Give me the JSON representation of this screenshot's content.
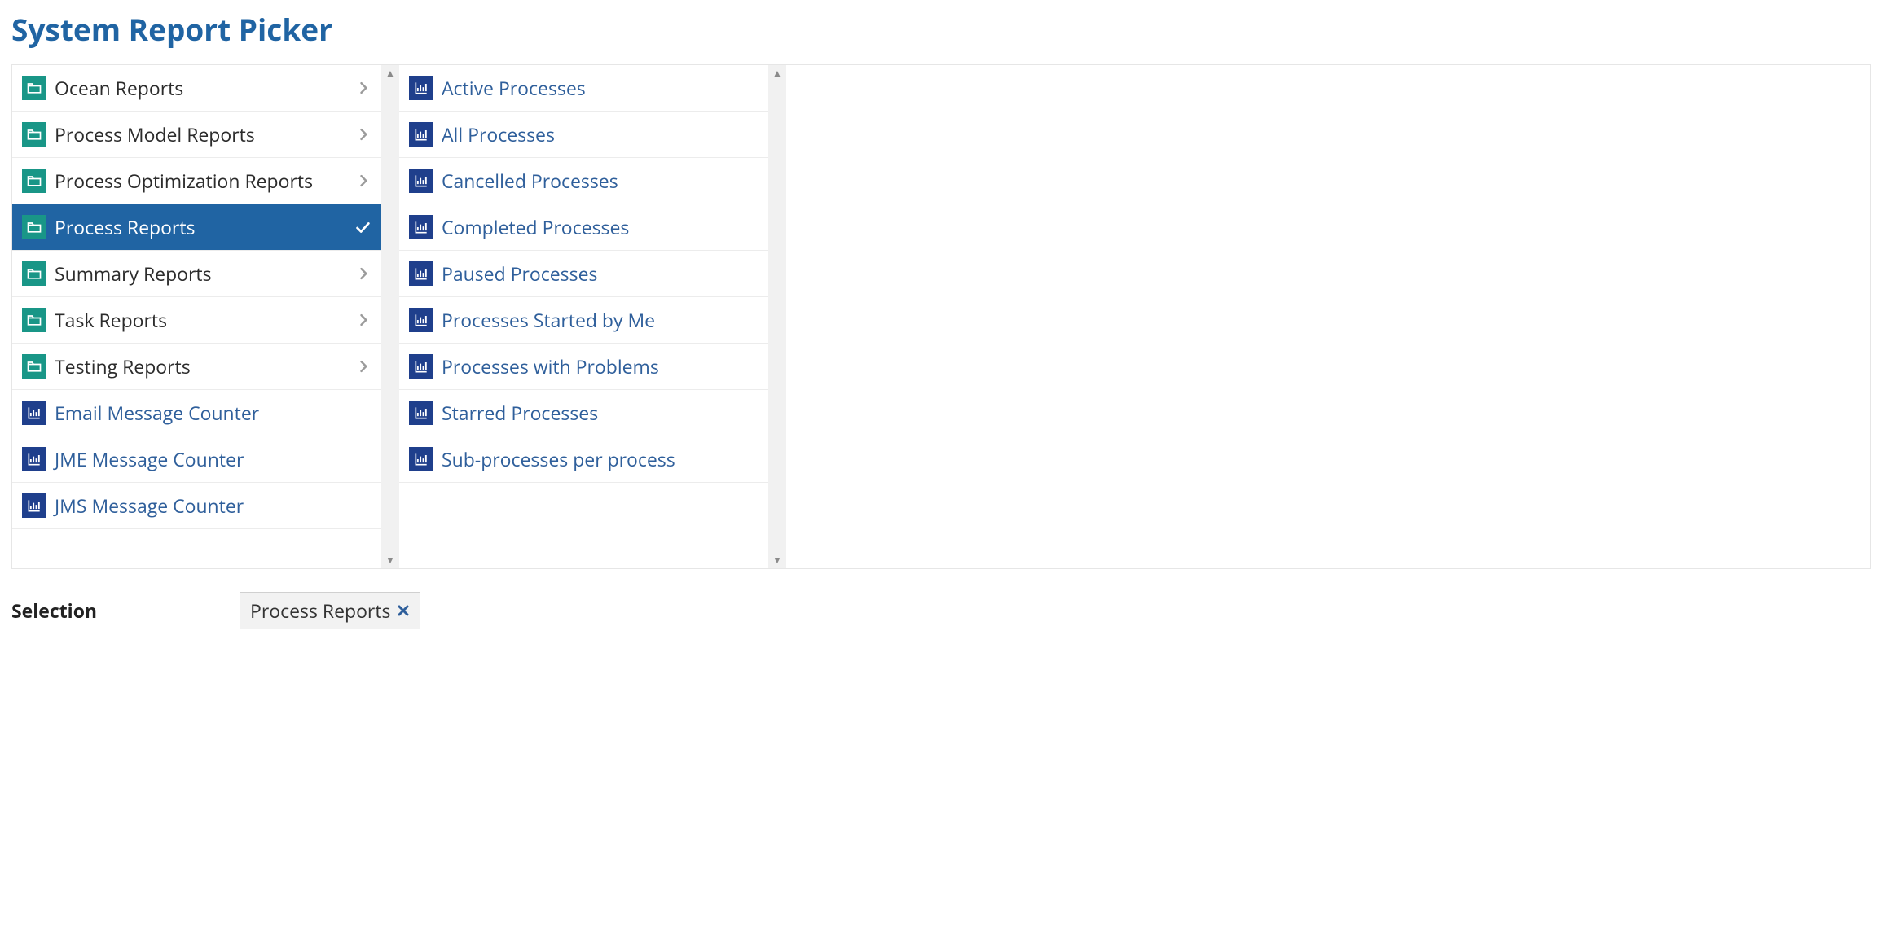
{
  "title": "System Report Picker",
  "leftColumn": [
    {
      "type": "folder",
      "label": "Ocean Reports",
      "selected": false,
      "hasChildren": true
    },
    {
      "type": "folder",
      "label": "Process Model Reports",
      "selected": false,
      "hasChildren": true
    },
    {
      "type": "folder",
      "label": "Process Optimization Reports",
      "selected": false,
      "hasChildren": true
    },
    {
      "type": "folder",
      "label": "Process Reports",
      "selected": true,
      "hasChildren": true
    },
    {
      "type": "folder",
      "label": "Summary Reports",
      "selected": false,
      "hasChildren": true
    },
    {
      "type": "folder",
      "label": "Task Reports",
      "selected": false,
      "hasChildren": true
    },
    {
      "type": "folder",
      "label": "Testing Reports",
      "selected": false,
      "hasChildren": true
    },
    {
      "type": "report",
      "label": "Email Message Counter",
      "selected": false
    },
    {
      "type": "report",
      "label": "JME Message Counter",
      "selected": false
    },
    {
      "type": "report",
      "label": "JMS Message Counter",
      "selected": false
    }
  ],
  "middleColumn": [
    {
      "type": "report",
      "label": "Active Processes"
    },
    {
      "type": "report",
      "label": "All Processes"
    },
    {
      "type": "report",
      "label": "Cancelled Processes"
    },
    {
      "type": "report",
      "label": "Completed Processes"
    },
    {
      "type": "report",
      "label": "Paused Processes"
    },
    {
      "type": "report",
      "label": "Processes Started by Me"
    },
    {
      "type": "report",
      "label": "Processes with Problems"
    },
    {
      "type": "report",
      "label": "Starred Processes"
    },
    {
      "type": "report",
      "label": "Sub-processes per process"
    }
  ],
  "selection": {
    "label": "Selection",
    "chip": "Process Reports"
  }
}
